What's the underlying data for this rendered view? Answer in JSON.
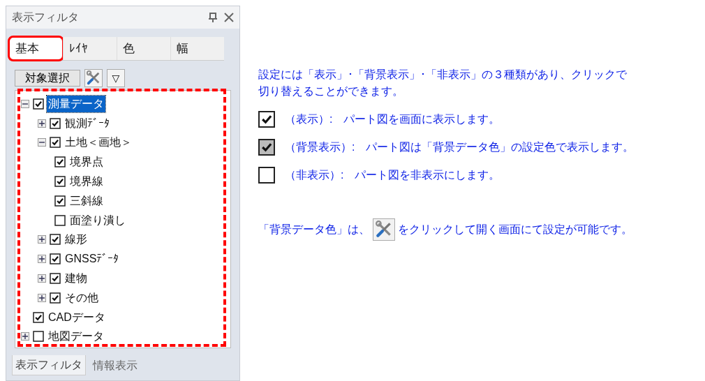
{
  "panel": {
    "title": "表示フィルタ",
    "tabs": [
      {
        "label": "基本",
        "selected": true,
        "highlighted": true
      },
      {
        "label": "ﾚｲﾔ",
        "selected": false,
        "highlighted": false
      },
      {
        "label": "色",
        "selected": false,
        "highlighted": false
      },
      {
        "label": "幅",
        "selected": false,
        "highlighted": false
      }
    ],
    "toolbar": {
      "select_button": "対象選択",
      "filter_button": "▽"
    },
    "tree_highlighted": true,
    "tree": [
      {
        "label": "測量データ",
        "checked": true,
        "expanded": true,
        "selected": true,
        "children": [
          {
            "label": "観測ﾃﾞｰﾀ",
            "checked": true,
            "expanded": false,
            "selected": false
          },
          {
            "label": "土地＜画地＞",
            "checked": true,
            "expanded": true,
            "selected": false,
            "children": [
              {
                "label": "境界点",
                "checked": true,
                "selected": false
              },
              {
                "label": "境界線",
                "checked": true,
                "selected": false
              },
              {
                "label": "三斜線",
                "checked": true,
                "selected": false
              },
              {
                "label": "面塗り潰し",
                "checked": false,
                "selected": false
              }
            ]
          },
          {
            "label": "線形",
            "checked": true,
            "expanded": false,
            "selected": false
          },
          {
            "label": "GNSSﾃﾞｰﾀ",
            "checked": true,
            "expanded": false,
            "selected": false
          },
          {
            "label": "建物",
            "checked": true,
            "expanded": false,
            "selected": false
          },
          {
            "label": "その他",
            "checked": true,
            "expanded": false,
            "selected": false
          }
        ]
      },
      {
        "label": "CADデータ",
        "checked": true,
        "selected": false
      },
      {
        "label": "地図データ",
        "checked": false,
        "expanded": false,
        "selected": false
      }
    ],
    "bottom_tabs": [
      {
        "label": "表示フィルタ",
        "selected": true
      },
      {
        "label": "情報表示",
        "selected": false
      }
    ]
  },
  "help": {
    "intro": [
      "設定には「表示」･「背景表示」･「非表示」の３種類があり、クリックで",
      "切り替えることができます。"
    ],
    "legend": [
      {
        "checked": true,
        "dimmed": false,
        "text": "（表示）:　パート図を画面に表示します。"
      },
      {
        "checked": true,
        "dimmed": true,
        "text": "（背景表示）:　パート図は「背景データ色」の設定色で表示します。"
      },
      {
        "checked": false,
        "dimmed": false,
        "text": "（非表示）:　パート図を非表示にします。"
      }
    ],
    "note_before": "「背景データ色」は、",
    "note_after": "をクリックして開く画面にて設定が可能です。"
  }
}
